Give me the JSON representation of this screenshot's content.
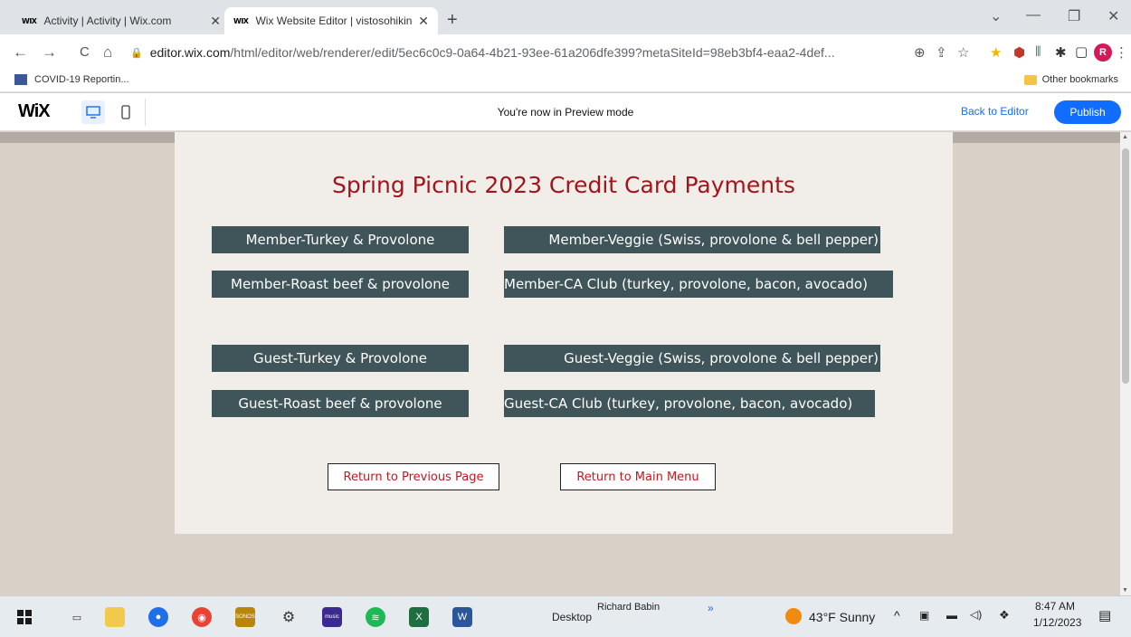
{
  "browser": {
    "tabs": [
      {
        "favicon": "WIX",
        "title": "Activity | Activity | Wix.com",
        "close": "✕"
      },
      {
        "favicon": "WIX",
        "title": "Wix Website Editor | vistosohiking",
        "close": "✕"
      }
    ],
    "new_tab": "+",
    "window_controls": {
      "minimize": "—",
      "restore": "❐",
      "close": "✕",
      "dropdown": "⌄"
    },
    "nav": {
      "back": "←",
      "forward": "→",
      "reload": "C",
      "home": "⌂"
    },
    "address": {
      "host": "editor.wix.com",
      "path": "/html/editor/web/renderer/edit/5ec6c0c9-0a64-4b21-93ee-61a206dfe399?metaSiteId=98eb3bf4-eaa2-4def..."
    },
    "profile_initial": "R",
    "bookmarks": {
      "left": "COVID-19 Reportin...",
      "right": "Other bookmarks"
    }
  },
  "wix": {
    "logo": "WiX",
    "preview_message": "You're now in Preview mode",
    "back_to_editor": "Back to Editor",
    "publish": "Publish"
  },
  "page": {
    "title": "Spring Picnic 2023 Credit Card Payments",
    "member_buttons": [
      "Member-Turkey & Provolone",
      "Member-Veggie (Swiss, provolone & bell pepper)",
      "Member-Roast beef & provolone",
      "Member-CA Club (turkey, provolone, bacon, avocado)"
    ],
    "guest_buttons": [
      "Guest-Turkey & Provolone",
      "Guest-Veggie (Swiss, provolone & bell pepper)",
      "Guest-Roast beef & provolone",
      "Guest-CA Club (turkey, provolone, bacon, avocado)"
    ],
    "return_previous": "Return to Previous Page",
    "return_main": "Return to Main Menu"
  },
  "taskbar": {
    "desktop": "Desktop",
    "user": "Richard Babin",
    "chevrons": "»",
    "weather": "43°F  Sunny",
    "time": "8:47 AM",
    "date": "1/12/2023"
  },
  "colors": {
    "accent_title": "#a3151c",
    "button_dark": "#3f5559",
    "wix_blue": "#116dff"
  }
}
